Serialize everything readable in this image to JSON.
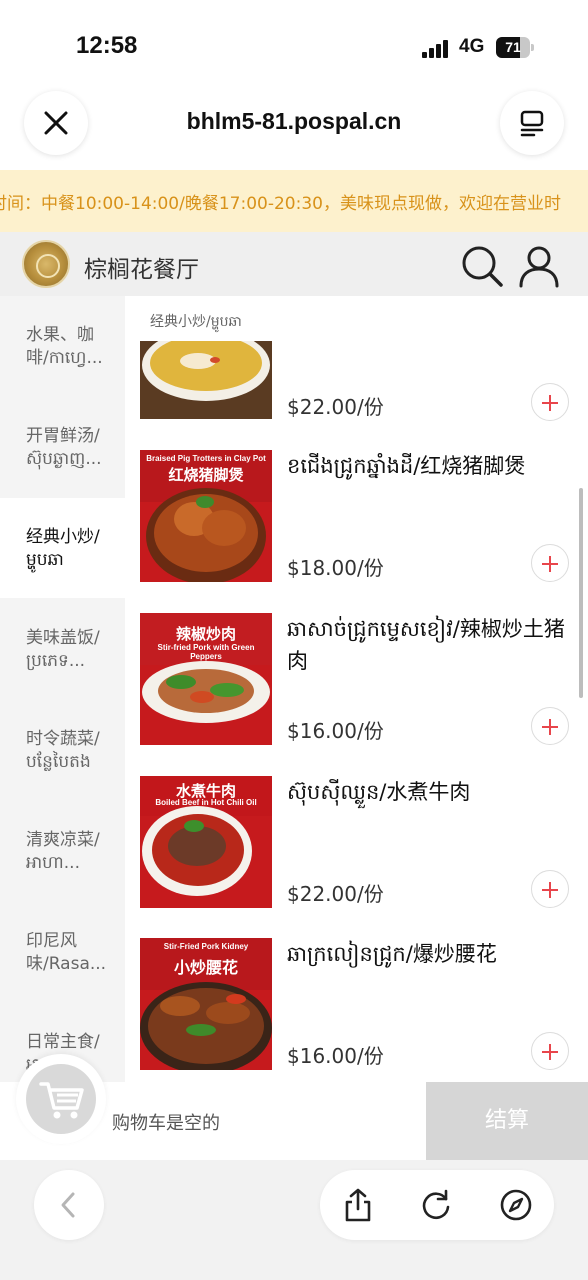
{
  "status_bar": {
    "time": "12:58",
    "network": "4G",
    "battery": "71",
    "battery_level": 0.71
  },
  "browser": {
    "url": "bhlm5-81.pospal.cn",
    "close_icon": "close-icon",
    "menu_icon": "menu-icon"
  },
  "notice": {
    "text": "时间：中餐10:00-14:00/晚餐17:00-20:30，美味现点现做，欢迎在营业时"
  },
  "store": {
    "name": "棕榈花餐厅",
    "logo_icon": "restaurant-logo",
    "search_icon": "search-icon",
    "user_icon": "user-icon"
  },
  "categories": [
    {
      "label": "水果、咖啡/កាហ្វេ...",
      "active": false
    },
    {
      "label": "开胃鲜汤/ស៊ុបឆ្ងាញ...",
      "active": false
    },
    {
      "label": "经典小炒/ម្ហូបឆា",
      "active": true
    },
    {
      "label": "美味盖饭/ប្រភេទ...",
      "active": false
    },
    {
      "label": "时令蔬菜/បន្លែបៃតង",
      "active": false
    },
    {
      "label": "清爽凉菜/អាហា...",
      "active": false
    },
    {
      "label": "印尼风味/Rasa...",
      "active": false
    },
    {
      "label": "日常主食/អាហា",
      "active": false
    }
  ],
  "section_title": "经典小炒/ម្ហូបឆា",
  "items": [
    {
      "name": "",
      "price": "$22.00/份",
      "image_title": "",
      "image_subtitle": ""
    },
    {
      "name": "ខជើងជ្រូកឆ្នាំងដី/红烧猪脚煲",
      "price": "$18.00/份",
      "image_title": "红烧猪脚煲",
      "image_subtitle": "Braised Pig Trotters in Clay Pot"
    },
    {
      "name": "ឆាសាច់ជ្រូកម្ទេសខៀវ/辣椒炒土猪肉",
      "price": "$16.00/份",
      "image_title": "辣椒炒肉",
      "image_subtitle": "Stir-fried Pork with Green Peppers"
    },
    {
      "name": "ស៊ុបសុីឈ្លួន/水煮牛肉",
      "price": "$22.00/份",
      "image_title": "水煮牛肉",
      "image_subtitle": "Boiled Beef in Hot Chili Oil"
    },
    {
      "name": "ឆាក្រលៀនជ្រូក/爆炒腰花",
      "price": "$16.00/份",
      "image_title": "小炒腰花",
      "image_subtitle": "Stir-Fried Pork Kidney"
    }
  ],
  "cart": {
    "empty_text": "购物车是空的",
    "checkout_label": "结算",
    "cart_icon": "cart-icon"
  },
  "toolbar": {
    "back_icon": "chevron-left-icon",
    "share_icon": "share-icon",
    "reload_icon": "reload-icon",
    "compass_icon": "compass-icon"
  },
  "colors": {
    "accent": "#e8454b",
    "notice_bg": "#fdf1cd",
    "notice_text": "#d8921a",
    "checkout_bg": "#d6d6d6"
  }
}
